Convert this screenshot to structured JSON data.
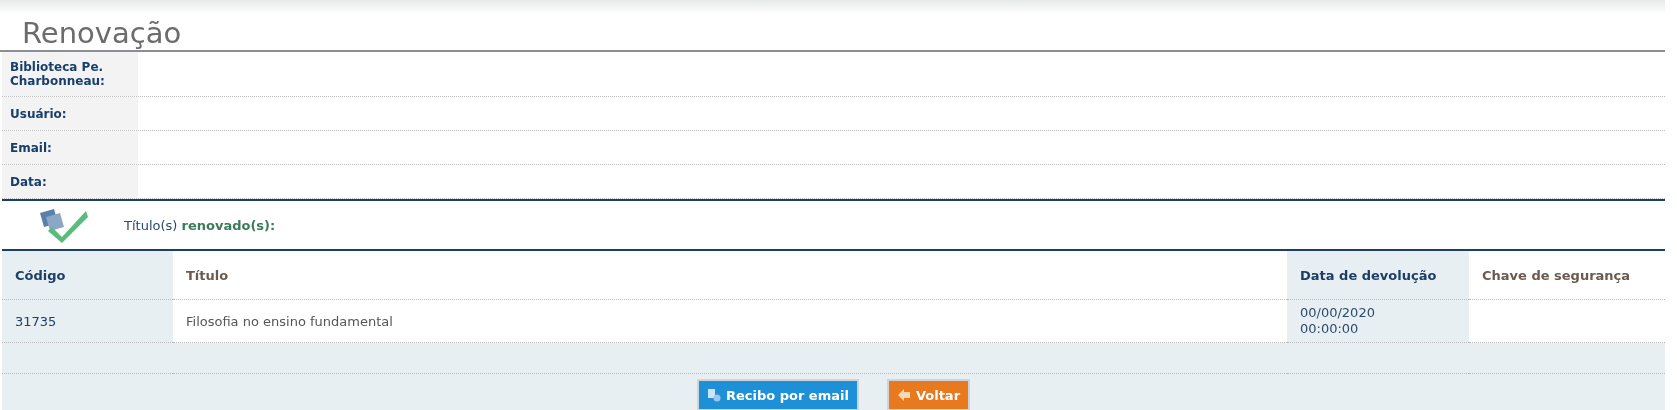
{
  "page_title": "Renovação",
  "info_rows": [
    {
      "label": "Biblioteca Pe. Charbonneau:"
    },
    {
      "label": "Usuário:"
    },
    {
      "label": "Email:"
    },
    {
      "label": "Data:"
    }
  ],
  "status_message": "Título(s) **renovado(s):**",
  "table": {
    "columns": [
      {
        "label": "Código",
        "highlighted": true
      },
      {
        "label": "Título",
        "highlighted": false
      },
      {
        "label": "Data de devolução",
        "highlighted": true
      },
      {
        "label": "Chave de segurança",
        "highlighted": false
      }
    ],
    "rows": [
      [
        "31735",
        "Filosofia no ensino fundamental",
        "00/00/2020 00:00:00",
        ""
      ]
    ]
  },
  "buttons": [
    {
      "label": "Recibo por email",
      "kind": "email"
    },
    {
      "label": "Voltar",
      "kind": "back"
    }
  ]
}
